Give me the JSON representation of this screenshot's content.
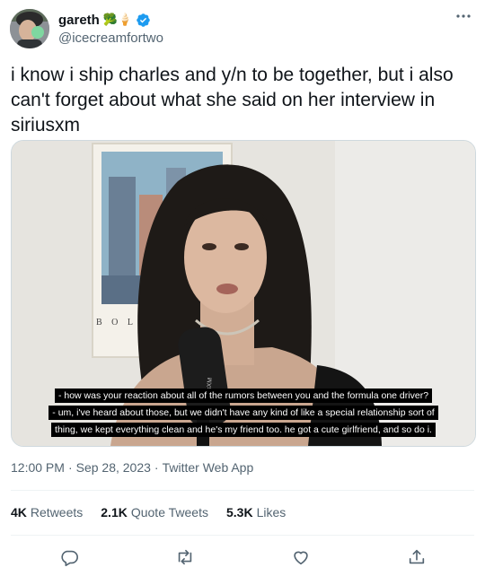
{
  "author": {
    "name": "gareth",
    "emoji": "🥦🍦",
    "handle": "@icecreamfortwo",
    "verified": true
  },
  "tweet": {
    "text": "i know i ship charles and y/n to be together, but i also can't forget about what she said on her interview in siriusxm"
  },
  "media": {
    "poster_text": "B O L",
    "mic_label": "SiriusXM",
    "subtitles": [
      "- how was your reaction about all of the rumors between you and the formula one driver?",
      "- um, i've heard about those, but we didn't have any kind of like a special relationship sort of",
      "thing, we kept everything clean and he's my friend too. he got a cute girlfriend, and so do i."
    ]
  },
  "meta": {
    "time": "12:00 PM",
    "date": "Sep 28, 2023",
    "source": "Twitter Web App",
    "sep": "·"
  },
  "stats": {
    "retweets_count": "4K",
    "retweets_label": "Retweets",
    "quotes_count": "2.1K",
    "quotes_label": "Quote Tweets",
    "likes_count": "5.3K",
    "likes_label": "Likes"
  },
  "colors": {
    "verified": "#1d9bf0",
    "secondary_text": "#536471",
    "divider": "#eff3f4"
  },
  "icons": [
    "more-icon",
    "verified-badge-icon",
    "reply-icon",
    "retweet-icon",
    "like-icon",
    "share-icon"
  ]
}
